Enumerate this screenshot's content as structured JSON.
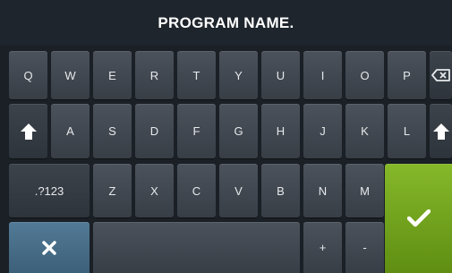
{
  "header": {
    "title": "PROGRAM NAME."
  },
  "keyboard": {
    "row1": [
      "Q",
      "W",
      "E",
      "R",
      "T",
      "Y",
      "U",
      "I",
      "O",
      "P"
    ],
    "row2": [
      "A",
      "S",
      "D",
      "F",
      "G",
      "H",
      "J",
      "K",
      "L"
    ],
    "row3": [
      "Z",
      "X",
      "C",
      "V",
      "B",
      "N",
      "M"
    ],
    "symbols_label": ".?123",
    "plus_label": "+",
    "minus_label": "-",
    "icons": {
      "backspace": "backspace-icon",
      "shift": "shift-arrow-icon",
      "close": "close-x-icon",
      "enter": "checkmark-icon"
    }
  },
  "colors": {
    "confirm_key": "#7aaa22",
    "cancel_key": "#4a6f8a"
  }
}
